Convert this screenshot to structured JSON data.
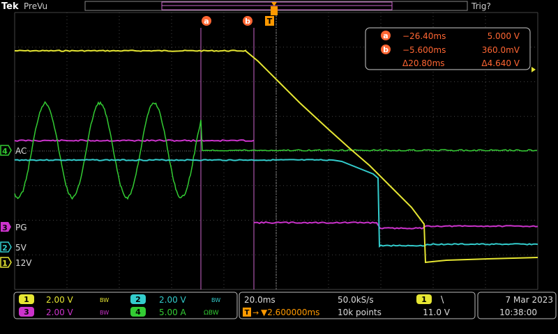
{
  "header": {
    "brand": "Tek",
    "mode": "PreVu",
    "trigger_status": "Trig?"
  },
  "cursor_markers": {
    "a": "a",
    "b": "b",
    "trigger": "T"
  },
  "readout": {
    "a": {
      "label": "a",
      "time": "−26.40ms",
      "value": "5.000 V"
    },
    "b": {
      "label": "b",
      "time": "−5.600ms",
      "value": "360.0mV"
    },
    "delta": {
      "time": "Δ20.80ms",
      "value": "Δ4.640 V"
    }
  },
  "channels": [
    {
      "id": "4",
      "name": "AC",
      "color": "#33cc33"
    },
    {
      "id": "3",
      "name": "PG",
      "color": "#cc33cc"
    },
    {
      "id": "2",
      "name": "5V",
      "color": "#33cccc"
    },
    {
      "id": "1",
      "name": "12V",
      "color": "#e6e633"
    }
  ],
  "status": {
    "ch1": {
      "id": "1",
      "scale": "2.00 V",
      "bw": "BW"
    },
    "ch2": {
      "id": "2",
      "scale": "2.00 V",
      "bw": "BW"
    },
    "ch3": {
      "id": "3",
      "scale": "2.00 V",
      "bw": "BW"
    },
    "ch4": {
      "id": "4",
      "scale": "5.00 A",
      "bw": "ΩBW"
    },
    "timebase": "20.0ms",
    "sample_rate": "50.0kS/s",
    "delay": "▼2.600000ms",
    "record_length": "10k points",
    "trigger": {
      "source": "1",
      "slope": "\\",
      "level": "11.0 V"
    },
    "date": "7 Mar  2023",
    "time": "10:38:00"
  },
  "colors": {
    "ch1": "#e6e633",
    "ch2": "#33cccc",
    "ch3": "#cc33cc",
    "ch4": "#33cc33",
    "cursor": "#cc66cc",
    "trigger": "#ff9900",
    "grid": "#555555"
  }
}
